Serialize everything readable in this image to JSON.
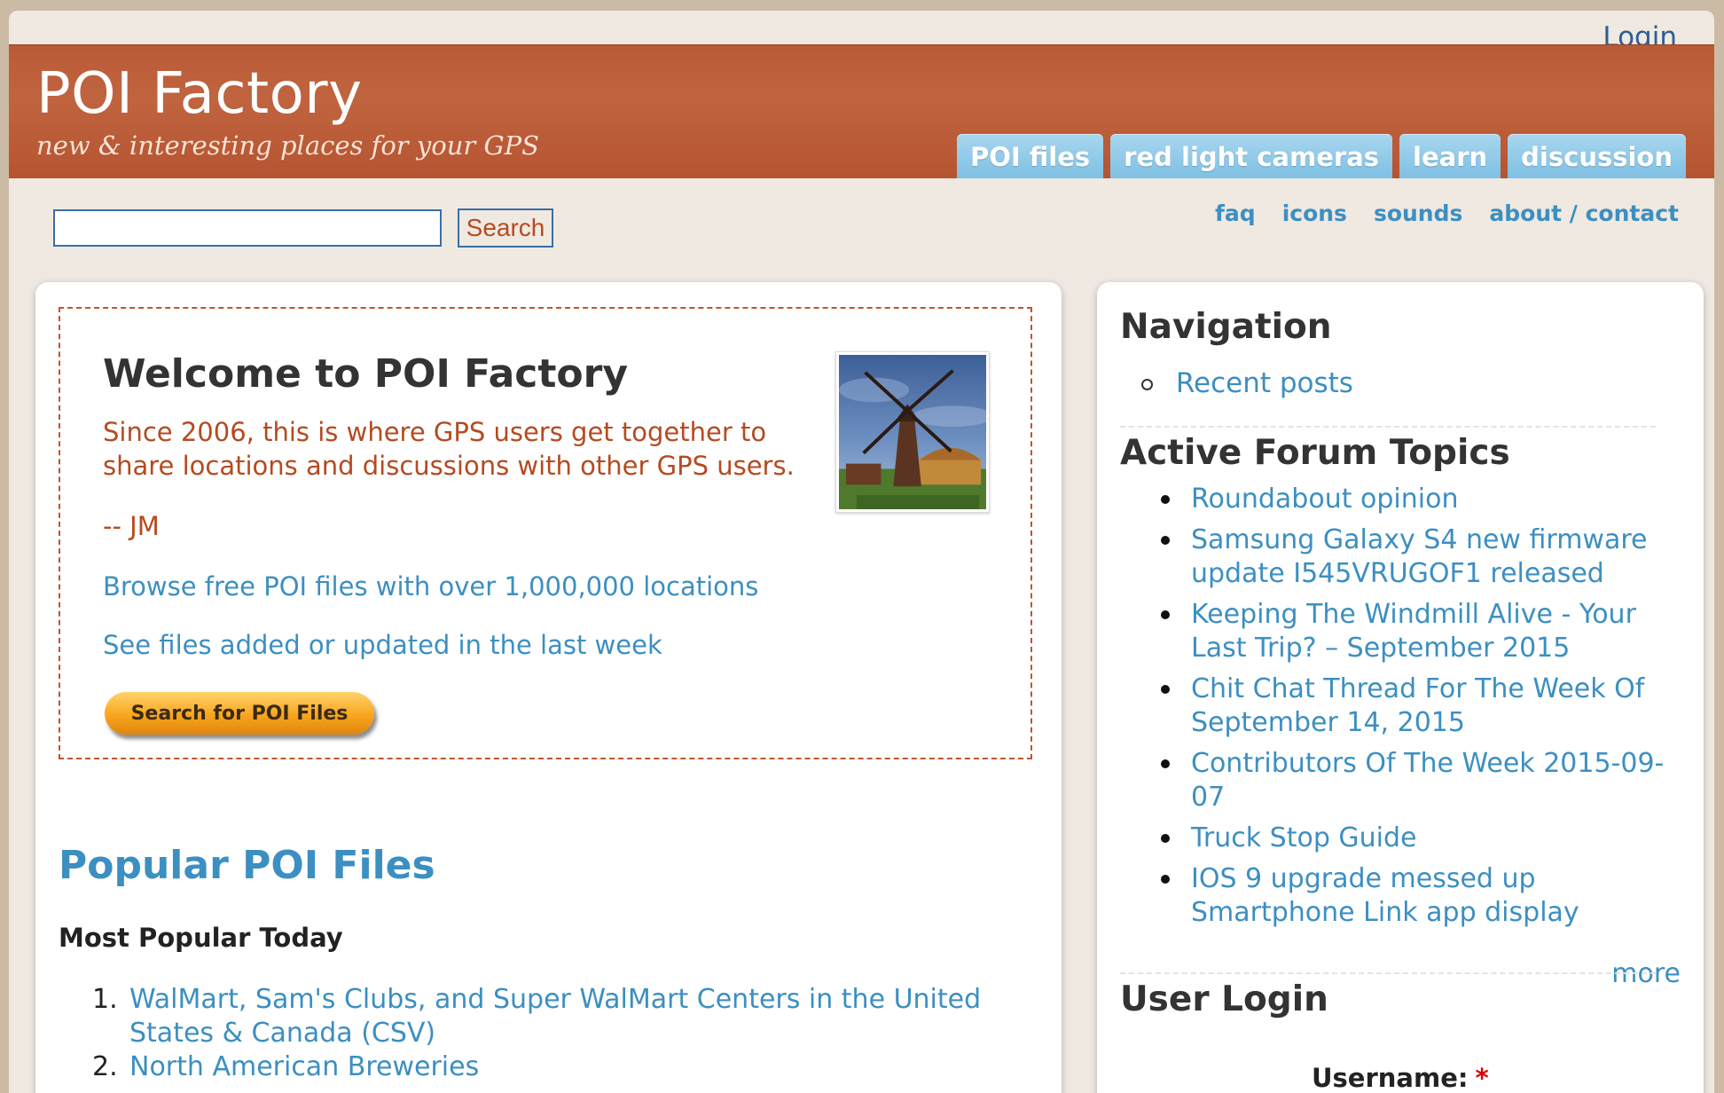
{
  "header": {
    "login": "Login",
    "site_title": "POI Factory",
    "slogan": "new & interesting places for your GPS",
    "tabs": [
      "POI files",
      "red light cameras",
      "learn",
      "discussion"
    ]
  },
  "search": {
    "button": "Search",
    "value": ""
  },
  "secondary_links": [
    "faq",
    "icons",
    "sounds",
    "about / contact"
  ],
  "welcome": {
    "title": "Welcome to POI Factory",
    "intro": "Since 2006, this is where GPS users get together to share locations and discussions with other GPS users.",
    "signature": "-- JM",
    "browse_link": "Browse free POI files with over 1,000,000 locations",
    "recent_link": "See files added or updated in the last week",
    "search_button": "Search for POI Files"
  },
  "popular": {
    "title": "Popular POI Files",
    "subtitle": "Most Popular Today",
    "items": [
      {
        "num": "1.",
        "text": "WalMart, Sam's Clubs, and Super WalMart Centers in the United States & Canada (CSV)"
      },
      {
        "num": "2.",
        "text": "North American Breweries"
      }
    ]
  },
  "sidebar": {
    "navigation_title": "Navigation",
    "navigation_items": [
      "Recent posts"
    ],
    "forum_title": "Active Forum Topics",
    "forum_topics": [
      "Roundabout opinion",
      "Samsung Galaxy S4 new firmware update I545VRUGOF1 released",
      "Keeping The Windmill Alive - Your Last Trip? – September 2015",
      "Chit Chat Thread For The Week Of September 14, 2015",
      "Contributors Of The Week 2015-09-07",
      "Truck Stop Guide",
      "IOS 9 upgrade messed up Smartphone Link app display"
    ],
    "more": "more",
    "login_title": "User Login",
    "username_label": "Username:",
    "required_mark": "*"
  },
  "colors": {
    "header": "#bb5c38",
    "tab": "#8ccae8",
    "link": "#3c8fc1",
    "accent_text": "#b54a20"
  }
}
